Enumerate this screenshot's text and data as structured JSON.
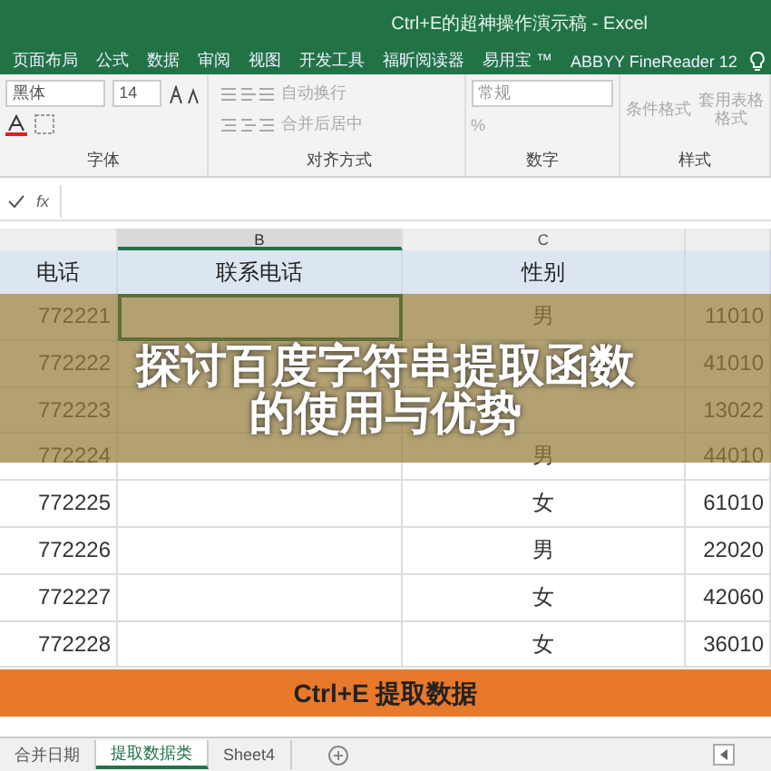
{
  "window": {
    "title": "Ctrl+E的超神操作演示稿 - Excel"
  },
  "ribbon_tabs": [
    {
      "label": "页面布局",
      "selected": false
    },
    {
      "label": "公式",
      "selected": false
    },
    {
      "label": "数据",
      "selected": false
    },
    {
      "label": "审阅",
      "selected": false
    },
    {
      "label": "视图",
      "selected": false
    },
    {
      "label": "开发工具",
      "selected": false
    },
    {
      "label": "福昕阅读器",
      "selected": false
    },
    {
      "label": "易用宝 ™",
      "selected": false
    },
    {
      "label": "ABBYY FineReader 12",
      "selected": false
    }
  ],
  "ribbon": {
    "font_name": "黑体",
    "font_size": "14",
    "wrap_text": "自动换行",
    "merge_center": "合并后居中",
    "number_format": "常规",
    "percent": "%",
    "conditional_format": "条件格式",
    "table_format": "套用表格格式",
    "groups": [
      "字体",
      "对齐方式",
      "数字",
      "样式"
    ]
  },
  "formula_bar": {
    "fx": "fx"
  },
  "columns": [
    {
      "selected": false
    },
    {
      "letter": "B",
      "selected": true
    },
    {
      "letter": "C",
      "selected": false
    },
    {
      "selected": false
    }
  ],
  "header_row": [
    "电话",
    "联系电话",
    "性别"
  ],
  "rows": [
    {
      "phone": "772221",
      "gender": "男",
      "id": "11010"
    },
    {
      "phone": "772222",
      "id": "41010"
    },
    {
      "phone": "772223",
      "id": "13022"
    },
    {
      "phone": "772224",
      "gender": "男",
      "id": "44010"
    },
    {
      "phone": "772225",
      "gender": "女",
      "id": "61010"
    },
    {
      "phone": "772226",
      "gender": "男",
      "id": "22020"
    },
    {
      "phone": "772227",
      "gender": "女",
      "id": "42060"
    },
    {
      "phone": "772228",
      "gender": "女",
      "id": "36010"
    }
  ],
  "overlay_title": [
    "探讨百度字符串提取函数",
    "的使用与优势"
  ],
  "caption": "Ctrl+E 提取数据",
  "sheet_tabs": [
    {
      "label": "合并日期",
      "selected": false
    },
    {
      "label": "提取数据类",
      "selected": true
    },
    {
      "label": "Sheet4",
      "selected": false
    }
  ]
}
